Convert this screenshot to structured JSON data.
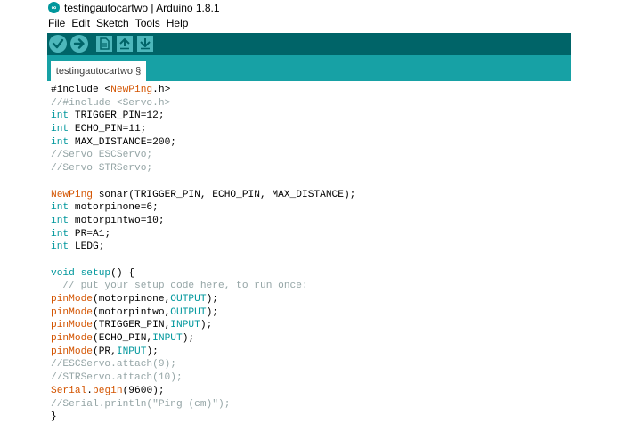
{
  "window": {
    "title": "testingautocartwo | Arduino 1.8.1",
    "app_icon_glyph": "∞"
  },
  "menu": {
    "items": [
      "File",
      "Edit",
      "Sketch",
      "Tools",
      "Help"
    ]
  },
  "toolbar": {
    "buttons": [
      "verify-icon",
      "upload-icon",
      "new-icon",
      "open-icon",
      "save-icon"
    ]
  },
  "tabs": [
    {
      "label": "testingautocartwo §"
    }
  ],
  "colors": {
    "toolbar_bg": "#006468",
    "tabbar_bg": "#17a1a5",
    "button_bg": "#4db7bb",
    "keyword": "#00979c",
    "function": "#d35400",
    "comment": "#95a5a6"
  },
  "code": [
    [
      [
        "tx",
        "#include <"
      ],
      [
        "fn",
        "NewPing"
      ],
      [
        "tx",
        ".h>"
      ]
    ],
    [
      [
        "cm",
        "//#include <Servo.h>"
      ]
    ],
    [
      [
        "kw",
        "int"
      ],
      [
        "tx",
        " TRIGGER_PIN=12;"
      ]
    ],
    [
      [
        "kw",
        "int"
      ],
      [
        "tx",
        " ECHO_PIN=11;"
      ]
    ],
    [
      [
        "kw",
        "int"
      ],
      [
        "tx",
        " MAX_DISTANCE=200;"
      ]
    ],
    [
      [
        "cm",
        "//Servo ESCServo;"
      ]
    ],
    [
      [
        "cm",
        "//Servo STRServo;"
      ]
    ],
    [],
    [
      [
        "fn",
        "NewPing"
      ],
      [
        "tx",
        " sonar(TRIGGER_PIN, ECHO_PIN, MAX_DISTANCE);"
      ]
    ],
    [
      [
        "kw",
        "int"
      ],
      [
        "tx",
        " motorpinone=6;"
      ]
    ],
    [
      [
        "kw",
        "int"
      ],
      [
        "tx",
        " motorpintwo=10;"
      ]
    ],
    [
      [
        "kw",
        "int"
      ],
      [
        "tx",
        " PR=A1;"
      ]
    ],
    [
      [
        "kw",
        "int"
      ],
      [
        "tx",
        " LEDG;"
      ]
    ],
    [],
    [
      [
        "kw",
        "void"
      ],
      [
        "tx",
        " "
      ],
      [
        "kw",
        "setup"
      ],
      [
        "tx",
        "() {"
      ]
    ],
    [
      [
        "cm",
        "  // put your setup code here, to run once:"
      ]
    ],
    [
      [
        "fn",
        "pinMode"
      ],
      [
        "tx",
        "(motorpinone,"
      ],
      [
        "kw",
        "OUTPUT"
      ],
      [
        "tx",
        ");"
      ]
    ],
    [
      [
        "fn",
        "pinMode"
      ],
      [
        "tx",
        "(motorpintwo,"
      ],
      [
        "kw",
        "OUTPUT"
      ],
      [
        "tx",
        ");"
      ]
    ],
    [
      [
        "fn",
        "pinMode"
      ],
      [
        "tx",
        "(TRIGGER_PIN,"
      ],
      [
        "kw",
        "INPUT"
      ],
      [
        "tx",
        ");"
      ]
    ],
    [
      [
        "fn",
        "pinMode"
      ],
      [
        "tx",
        "(ECHO_PIN,"
      ],
      [
        "kw",
        "INPUT"
      ],
      [
        "tx",
        ");"
      ]
    ],
    [
      [
        "fn",
        "pinMode"
      ],
      [
        "tx",
        "(PR,"
      ],
      [
        "kw",
        "INPUT"
      ],
      [
        "tx",
        ");"
      ]
    ],
    [
      [
        "cm",
        "//ESCServo.attach(9);"
      ]
    ],
    [
      [
        "cm",
        "//STRServo.attach(10);"
      ]
    ],
    [
      [
        "fn",
        "Serial"
      ],
      [
        "tx",
        "."
      ],
      [
        "fn",
        "begin"
      ],
      [
        "tx",
        "(9600);"
      ]
    ],
    [
      [
        "cm",
        "//Serial.println(\"Ping (cm)\");"
      ]
    ],
    [
      [
        "tx",
        "}"
      ]
    ]
  ]
}
